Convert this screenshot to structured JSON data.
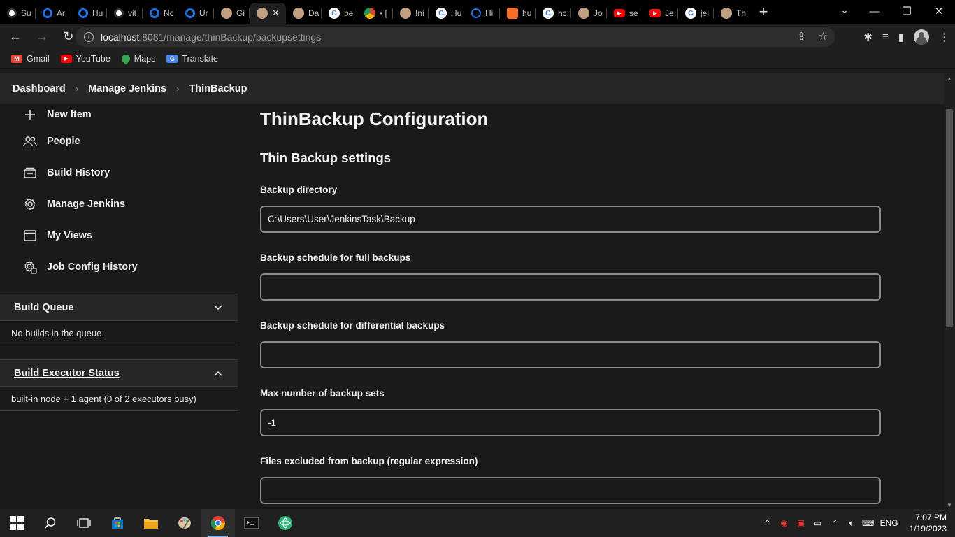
{
  "browser": {
    "tabs": [
      {
        "title": "Su",
        "icon": "github-icon",
        "color": "#333333"
      },
      {
        "title": "Ar",
        "icon": "ring-icon",
        "color": "#1a73e8"
      },
      {
        "title": "Hu",
        "icon": "ring-icon",
        "color": "#1a73e8"
      },
      {
        "title": "vit",
        "icon": "github-icon",
        "color": "#333333"
      },
      {
        "title": "Nc",
        "icon": "ring-icon",
        "color": "#1a73e8"
      },
      {
        "title": "Ur",
        "icon": "ring-icon",
        "color": "#1a73e8"
      },
      {
        "title": "Gi",
        "icon": "jenkins-icon",
        "color": "#c0a080"
      },
      {
        "title": "",
        "icon": "jenkins-icon",
        "color": "#c0a080",
        "active": true
      },
      {
        "title": "Da",
        "icon": "jenkins-icon",
        "color": "#c0a080"
      },
      {
        "title": "be",
        "icon": "google-icon",
        "color": "#ffffff"
      },
      {
        "title": "• [",
        "icon": "chrome-icon",
        "color": "#4285f4"
      },
      {
        "title": "Ini",
        "icon": "jenkins-icon",
        "color": "#c0a080"
      },
      {
        "title": "Hu",
        "icon": "google-icon",
        "color": "#ffffff"
      },
      {
        "title": "Hi",
        "icon": "history-icon",
        "color": "#1a73e8"
      },
      {
        "title": "hu",
        "icon": "gitlab-icon",
        "color": "#fc6d26"
      },
      {
        "title": "hc",
        "icon": "google-icon",
        "color": "#ffffff"
      },
      {
        "title": "Jo",
        "icon": "jenkins-icon",
        "color": "#c0a080"
      },
      {
        "title": "se",
        "icon": "youtube-icon",
        "color": "#ff0000"
      },
      {
        "title": "Je",
        "icon": "youtube-icon",
        "color": "#ff0000"
      },
      {
        "title": "jei",
        "icon": "google-icon",
        "color": "#ffffff"
      },
      {
        "title": "Th",
        "icon": "jenkins-icon",
        "color": "#c0a080"
      }
    ],
    "new_tab": "+",
    "url_host": "localhost",
    "url_path": ":8081/manage/thinBackup/backupsettings",
    "bookmarks": [
      {
        "label": "Gmail",
        "icon": "gmail-icon",
        "color": "#ea4335"
      },
      {
        "label": "YouTube",
        "icon": "youtube-icon",
        "color": "#ff0000"
      },
      {
        "label": "Maps",
        "icon": "maps-icon",
        "color": "#34a853"
      },
      {
        "label": "Translate",
        "icon": "translate-icon",
        "color": "#4285f4"
      }
    ]
  },
  "breadcrumbs": [
    "Dashboard",
    "Manage Jenkins",
    "ThinBackup"
  ],
  "sidebar": {
    "items": [
      {
        "label": "New Item",
        "icon": "plus-icon"
      },
      {
        "label": "People",
        "icon": "people-icon"
      },
      {
        "label": "Build History",
        "icon": "history-icon"
      },
      {
        "label": "Manage Jenkins",
        "icon": "gear-icon"
      },
      {
        "label": "My Views",
        "icon": "window-icon"
      },
      {
        "label": "Job Config History",
        "icon": "config-history-icon"
      }
    ],
    "build_queue": {
      "title": "Build Queue",
      "body": "No builds in the queue."
    },
    "executor": {
      "title": "Build Executor Status",
      "body": "built-in node + 1 agent (0 of 2 executors busy)"
    }
  },
  "main": {
    "title": "ThinBackup Configuration",
    "section": "Thin Backup settings",
    "fields": [
      {
        "label": "Backup directory",
        "value": "C:\\Users\\User\\JenkinsTask\\Backup"
      },
      {
        "label": "Backup schedule for full backups",
        "value": ""
      },
      {
        "label": "Backup schedule for differential backups",
        "value": ""
      },
      {
        "label": "Max number of backup sets",
        "value": "-1"
      },
      {
        "label": "Files excluded from backup (regular expression)",
        "value": ""
      }
    ]
  },
  "taskbar": {
    "language": "ENG",
    "time": "7:07 PM",
    "date": "1/19/2023"
  }
}
